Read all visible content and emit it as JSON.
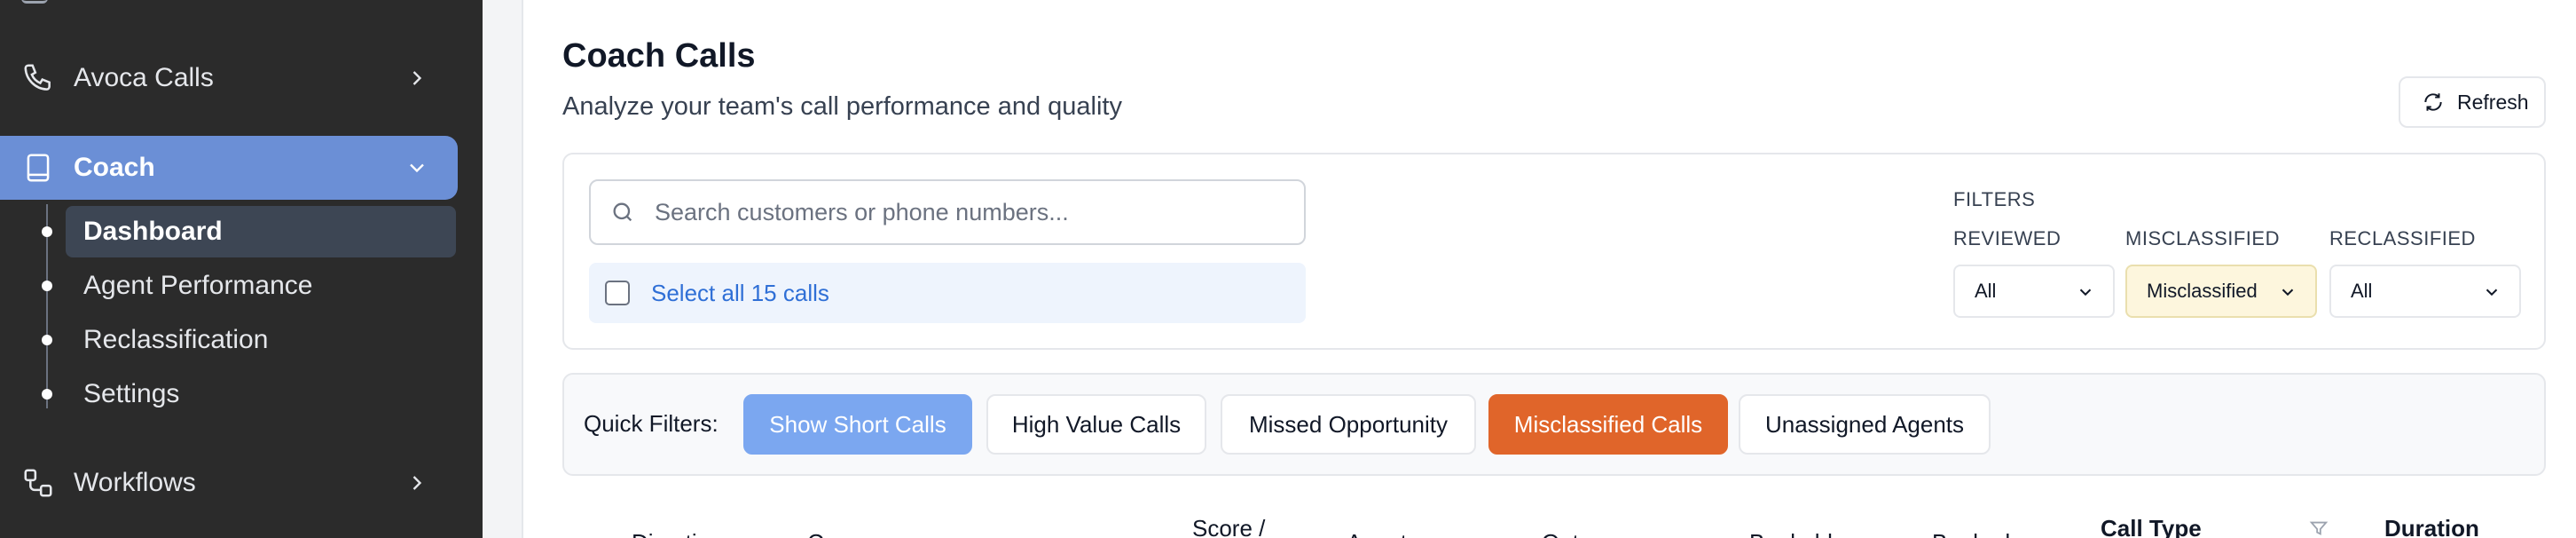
{
  "sidebar": {
    "items": [
      {
        "label": "Avoca Calls",
        "icon": "phone-icon"
      },
      {
        "label": "Coach",
        "icon": "book-icon"
      },
      {
        "label": "Workflows",
        "icon": "workflow-icon"
      }
    ],
    "coach_sub": [
      {
        "label": "Dashboard"
      },
      {
        "label": "Agent Performance"
      },
      {
        "label": "Reclassification"
      },
      {
        "label": "Settings"
      }
    ]
  },
  "header": {
    "title": "Coach Calls",
    "subtitle": "Analyze your team's call performance and quality",
    "refresh_label": "Refresh"
  },
  "search": {
    "placeholder": "Search customers or phone numbers...",
    "value": ""
  },
  "select_all": {
    "label": "Select all 15 calls"
  },
  "filters": {
    "heading": "FILTERS",
    "reviewed": {
      "label": "REVIEWED",
      "value": "All"
    },
    "misclassified": {
      "label": "MISCLASSIFIED",
      "value": "Misclassified"
    },
    "reclassified": {
      "label": "RECLASSIFIED",
      "value": "All"
    }
  },
  "quick_filters": {
    "label": "Quick Filters:",
    "chips": [
      {
        "label": "Show Short Calls",
        "state": "active-blue"
      },
      {
        "label": "High Value Calls",
        "state": "default"
      },
      {
        "label": "Missed Opportunity",
        "state": "default"
      },
      {
        "label": "Misclassified Calls",
        "state": "active-orange"
      },
      {
        "label": "Unassigned Agents",
        "state": "default"
      }
    ]
  },
  "table": {
    "headers": [
      "Direction",
      "Cu",
      "Score /",
      "Agent",
      "Outcome",
      "Bookable",
      "Booked",
      "Call Type",
      "Duration"
    ]
  },
  "colors": {
    "sidebar_bg": "#2b2b2b",
    "sidebar_active": "#6b8fd6",
    "chip_blue": "#7ba7f0",
    "chip_orange": "#e0652a",
    "link_blue": "#2f6fd6"
  }
}
